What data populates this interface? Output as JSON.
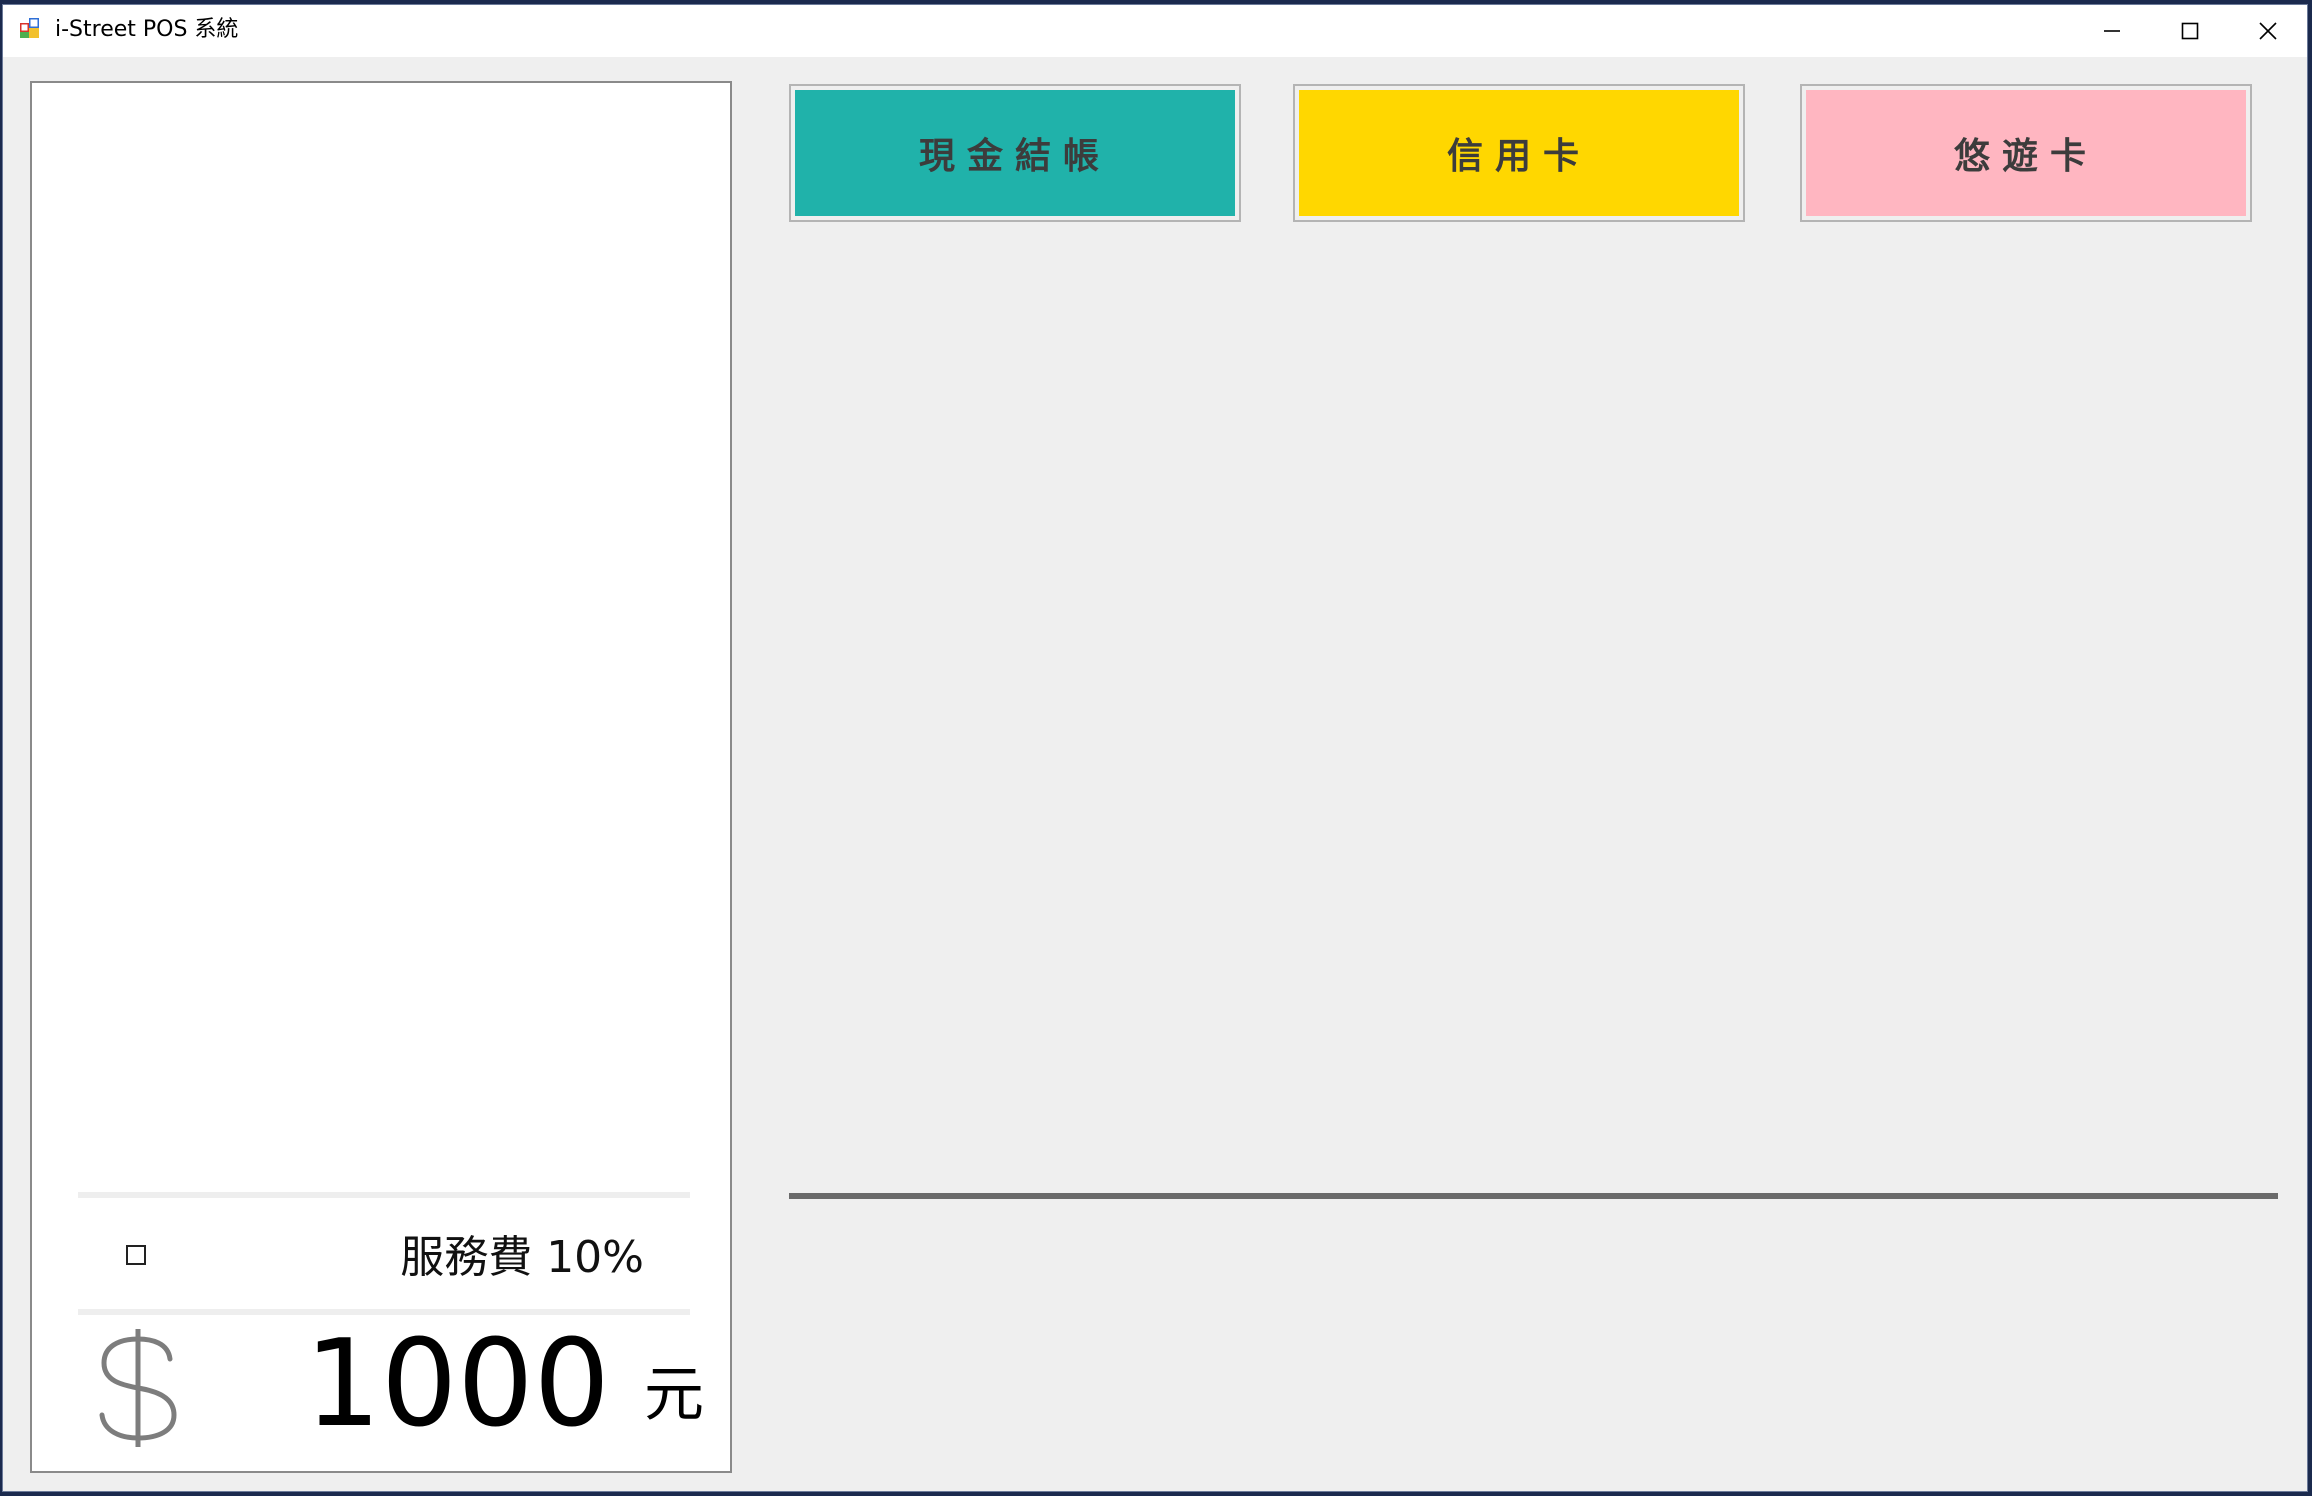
{
  "window": {
    "title": "i-Street POS 系統",
    "minimize": "minimize",
    "maximize": "maximize",
    "close": "close"
  },
  "order": {
    "service_fee_checked": false,
    "service_fee_label": "服務費 10%",
    "total_amount": "1000",
    "currency_unit": "元"
  },
  "payment_buttons": [
    {
      "label": "現金結帳",
      "color": "#20b2aa"
    },
    {
      "label": "信用卡",
      "color": "#ffd700"
    },
    {
      "label": "悠遊卡",
      "color": "#ffb6c1"
    }
  ],
  "icons": {
    "app": "app-icon",
    "dollar": "dollar-sign-icon"
  }
}
